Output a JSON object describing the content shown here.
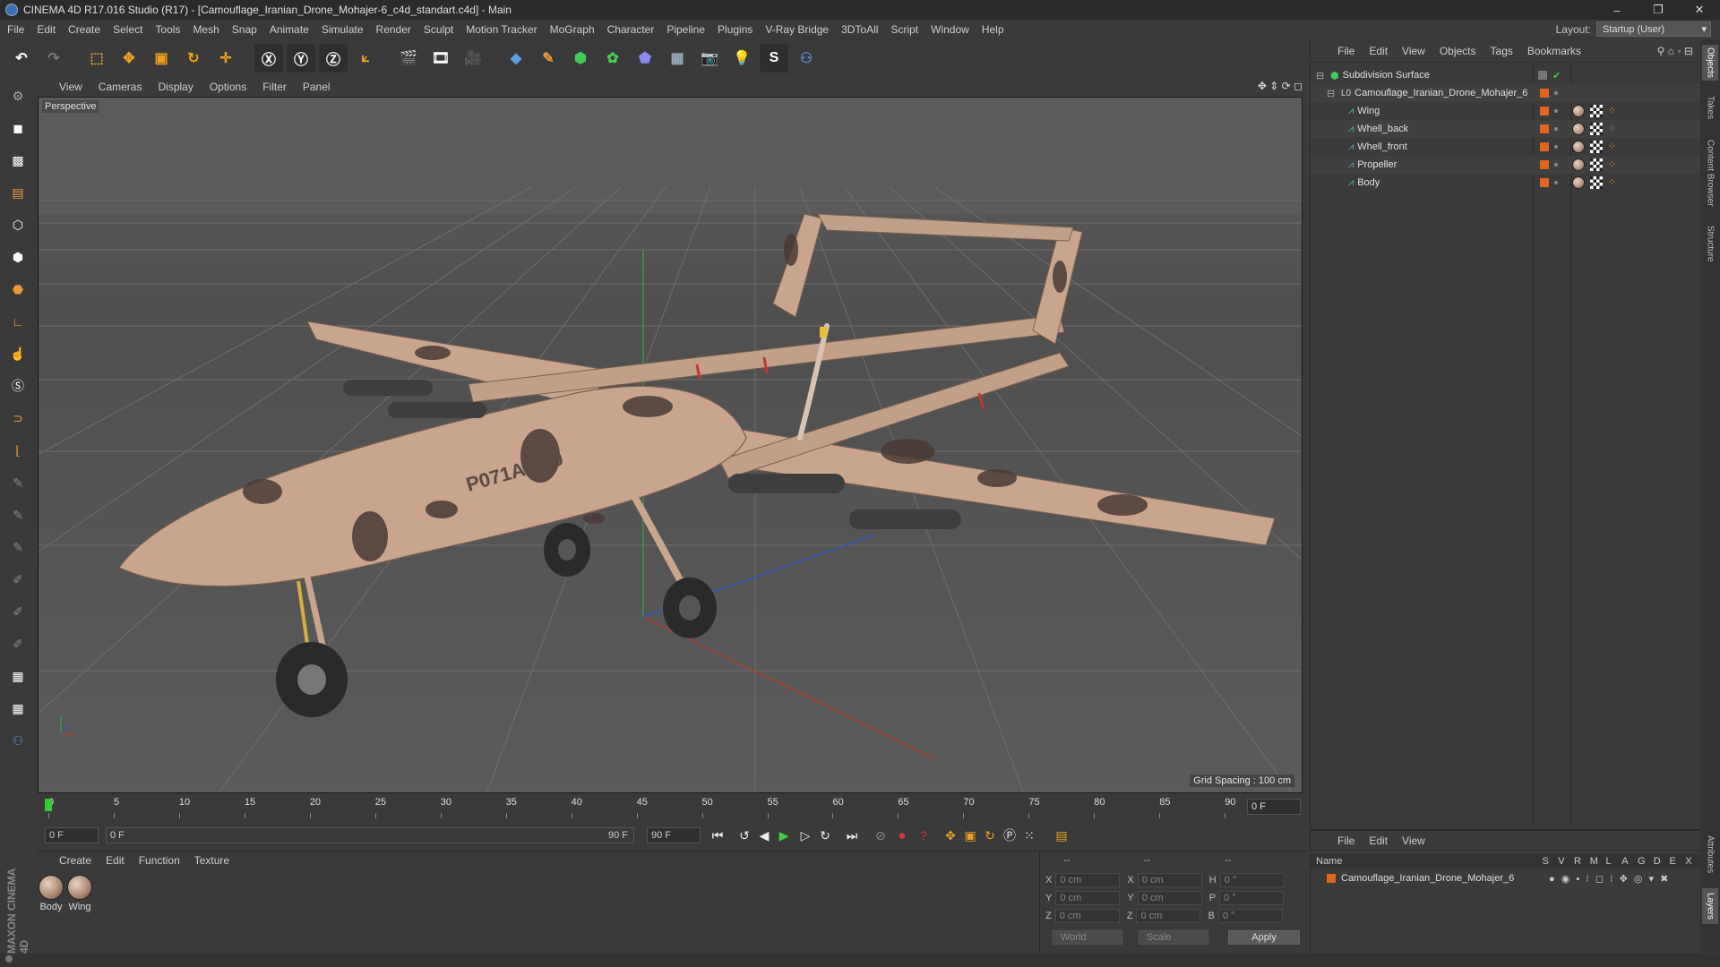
{
  "window": {
    "title": "CINEMA 4D R17.016 Studio (R17) - [Camouflage_Iranian_Drone_Mohajer-6_c4d_standart.c4d] - Main",
    "minimize": "–",
    "restore": "❐",
    "close": "✕"
  },
  "menubar": {
    "items": [
      "File",
      "Edit",
      "Create",
      "Select",
      "Tools",
      "Mesh",
      "Snap",
      "Animate",
      "Simulate",
      "Render",
      "Sculpt",
      "Motion Tracker",
      "MoGraph",
      "Character",
      "Pipeline",
      "Plugins",
      "V-Ray Bridge",
      "3DToAll",
      "Script",
      "Window",
      "Help"
    ],
    "layout_label": "Layout:",
    "layout_value": "Startup (User)"
  },
  "viewport": {
    "menu": [
      "View",
      "Cameras",
      "Display",
      "Options",
      "Filter",
      "Panel"
    ],
    "label": "Perspective",
    "grid_spacing": "Grid Spacing : 100 cm",
    "decal_text": "P071A-020"
  },
  "timeline": {
    "ticks": [
      "0",
      "5",
      "10",
      "15",
      "20",
      "25",
      "30",
      "35",
      "40",
      "45",
      "50",
      "55",
      "60",
      "65",
      "70",
      "75",
      "80",
      "85",
      "90"
    ],
    "current_frame": "0 F",
    "start_field": "0 F",
    "range_start": "0 F",
    "range_end": "90 F",
    "end_field": "90 F"
  },
  "materials": {
    "menu": [
      "Create",
      "Edit",
      "Function",
      "Texture"
    ],
    "items": [
      "Body",
      "Wing"
    ]
  },
  "coords": {
    "header": [
      "--",
      "--",
      "--"
    ],
    "rows": [
      {
        "a": "X",
        "av": "0 cm",
        "b": "X",
        "bv": "0 cm",
        "c": "H",
        "cv": "0 °"
      },
      {
        "a": "Y",
        "av": "0 cm",
        "b": "Y",
        "bv": "0 cm",
        "c": "P",
        "cv": "0 °"
      },
      {
        "a": "Z",
        "av": "0 cm",
        "b": "Z",
        "bv": "0 cm",
        "c": "B",
        "cv": "0 °"
      }
    ],
    "world": "World",
    "scale": "Scale",
    "apply": "Apply"
  },
  "objects": {
    "menu": [
      "File",
      "Edit",
      "View",
      "Objects",
      "Tags",
      "Bookmarks"
    ],
    "tree": [
      {
        "name": "Subdivision Surface",
        "indent": 0
      },
      {
        "name": "Camouflage_Iranian_Drone_Mohajer_6",
        "indent": 1
      },
      {
        "name": "Wing",
        "indent": 2
      },
      {
        "name": "Whell_back",
        "indent": 2
      },
      {
        "name": "Whell_front",
        "indent": 2
      },
      {
        "name": "Propeller",
        "indent": 2
      },
      {
        "name": "Body",
        "indent": 2
      }
    ]
  },
  "layers": {
    "menu": [
      "File",
      "Edit",
      "View"
    ],
    "columns": [
      "Name",
      "S",
      "V",
      "R",
      "M",
      "L",
      "A",
      "G",
      "D",
      "E",
      "X"
    ],
    "row": "Camouflage_Iranian_Drone_Mohajer_6"
  },
  "sidetabs": [
    "Objects",
    "Takes",
    "Content Browser",
    "Structure",
    "Attributes",
    "Layers"
  ],
  "brand": "MAXON CINEMA 4D",
  "colors": {
    "accent_orange": "#e0661f",
    "selection_blue": "#3d6fb8"
  }
}
